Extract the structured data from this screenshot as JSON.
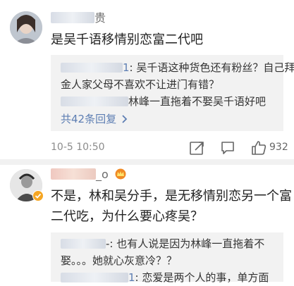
{
  "post1": {
    "username": "贵",
    "text": "是吴千语移情别恋富二代吧",
    "replies": [
      {
        "author": "1",
        "text": ": 吴千语这种货色还有粉丝？自己拜",
        "cont": "金人家父母不喜欢不让进门有错？"
      },
      {
        "author": "",
        "text": "林峰一直拖着不娶吴千语好吧"
      }
    ],
    "more_replies": "共42条回复",
    "time": "10-5 10:50",
    "likes": "932"
  },
  "post2": {
    "username": "_o",
    "text_line1": "不是，林和吴分手，是无移情别恋另一个富",
    "text_line2": "二代吃，为什么要心疼吴？",
    "replies": [
      {
        "author": "",
        "text": "-: 也有人说是因为林峰一直拖着不",
        "cont": "娶。。。她就心灰意冷？？"
      },
      {
        "author": "1",
        "text": ": 恋爱是两个人的事，单方面"
      }
    ]
  }
}
